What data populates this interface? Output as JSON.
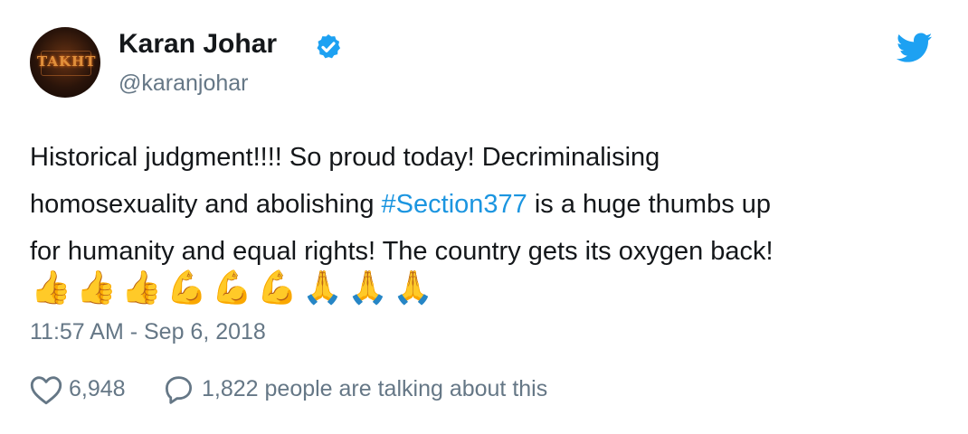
{
  "author": {
    "avatar_text": "TAKHT",
    "name": "Karan Johar",
    "verified": true,
    "handle": "@karanjohar"
  },
  "tweet": {
    "lines": [
      {
        "segments": [
          {
            "text": "Historical judgment!!!! So proud today! Decriminalising",
            "type": "text"
          }
        ]
      },
      {
        "segments": [
          {
            "text": "homosexuality and abolishing ",
            "type": "text"
          },
          {
            "text": "#Section377",
            "type": "hashtag"
          },
          {
            "text": " is a huge thumbs up",
            "type": "text"
          }
        ]
      },
      {
        "segments": [
          {
            "text": "for humanity and equal rights! The country gets its oxygen back!",
            "type": "text"
          }
        ]
      }
    ],
    "emojis": [
      "👍",
      "👍",
      "👍",
      "💪",
      "💪",
      "💪",
      "🙏",
      "🙏",
      "🙏"
    ],
    "emoji_names": [
      "thumbs-up",
      "thumbs-up",
      "thumbs-up",
      "flexed-biceps",
      "flexed-biceps",
      "flexed-biceps",
      "folded-hands",
      "folded-hands",
      "folded-hands"
    ],
    "timestamp": "11:57 AM - Sep 6, 2018"
  },
  "stats": {
    "likes": "6,948",
    "talking": "1,822 people are talking about this"
  },
  "colors": {
    "link": "#1b95e0",
    "muted": "#657786",
    "text": "#14171a",
    "twitter_blue": "#1da1f2"
  },
  "icons": {
    "verified": "verified-badge-icon",
    "brand": "twitter-bird-icon",
    "like": "heart-icon",
    "reply": "speech-bubble-icon"
  }
}
